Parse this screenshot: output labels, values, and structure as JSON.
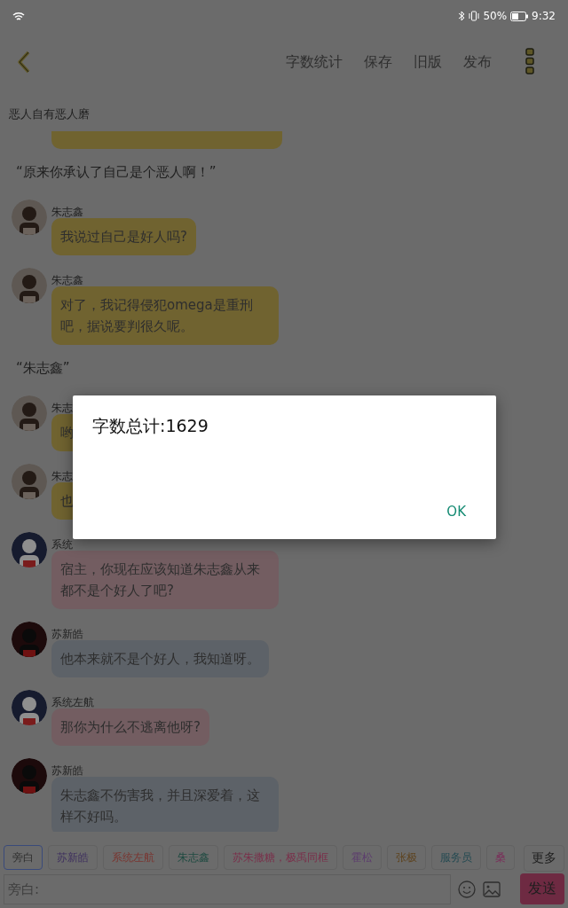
{
  "status_bar": {
    "battery": "50%",
    "time": "9:32"
  },
  "toolbar": {
    "actions": [
      "字数统计",
      "保存",
      "旧版",
      "发布"
    ]
  },
  "chapter_title": "恶人自有恶人磨",
  "messages": [
    {
      "kind": "clipped",
      "color": "#706330"
    },
    {
      "kind": "narration",
      "text": "“原来你承认了自己是个恶人啊！”"
    },
    {
      "kind": "message",
      "speaker": "朱志鑫",
      "text": "我说过自己是好人吗?",
      "color": "#706330"
    },
    {
      "kind": "message",
      "speaker": "朱志鑫",
      "text": "对了，我记得侵犯omega是重刑吧，据说要判很久呢。",
      "color": "#706330"
    },
    {
      "kind": "narration",
      "text": "“朱志鑫”"
    },
    {
      "kind": "message",
      "speaker": "朱志",
      "text": "哟",
      "color": "#706330"
    },
    {
      "kind": "message",
      "speaker": "朱志",
      "text": "也",
      "color": "#706330"
    },
    {
      "kind": "message",
      "speaker": "系统",
      "text": "宿主，你现在应该知道朱志鑫从来都不是个好人了吧?",
      "color": "#735d61"
    },
    {
      "kind": "message",
      "speaker": "苏新皓",
      "text": "他本来就不是个好人，我知道呀。",
      "color": "#5d6268"
    },
    {
      "kind": "message",
      "speaker": "系统左航",
      "text": "那你为什么不逃离他呀?",
      "color": "#735d61"
    },
    {
      "kind": "message",
      "speaker": "苏新皓",
      "text": "朱志鑫不伤害我，并且深爱着，这样不好吗。",
      "color": "#5d6268"
    }
  ],
  "role_tags": [
    {
      "label": "旁白",
      "selected": true,
      "color": "#2e2e2e"
    },
    {
      "label": "苏新皓",
      "selected": false,
      "color": "#3e2f5e"
    },
    {
      "label": "系统左航",
      "selected": false,
      "color": "#7a3530"
    },
    {
      "label": "朱志鑫",
      "selected": false,
      "color": "#1d4a40"
    },
    {
      "label": "苏朱撒糖，极禹同框",
      "selected": false,
      "color": "#7a2f4a"
    },
    {
      "label": "霍松",
      "selected": false,
      "color": "#5c3a6e"
    },
    {
      "label": "张极",
      "selected": false,
      "color": "#5e4420"
    },
    {
      "label": "服务员",
      "selected": false,
      "color": "#244a52"
    },
    {
      "label": "桑",
      "selected": false,
      "color": "#7a2f5a"
    }
  ],
  "more_button": "更多",
  "input": {
    "placeholder": "旁白:"
  },
  "send_button": "发送",
  "dialog": {
    "message": "字数总计:1629",
    "button": "OK"
  }
}
